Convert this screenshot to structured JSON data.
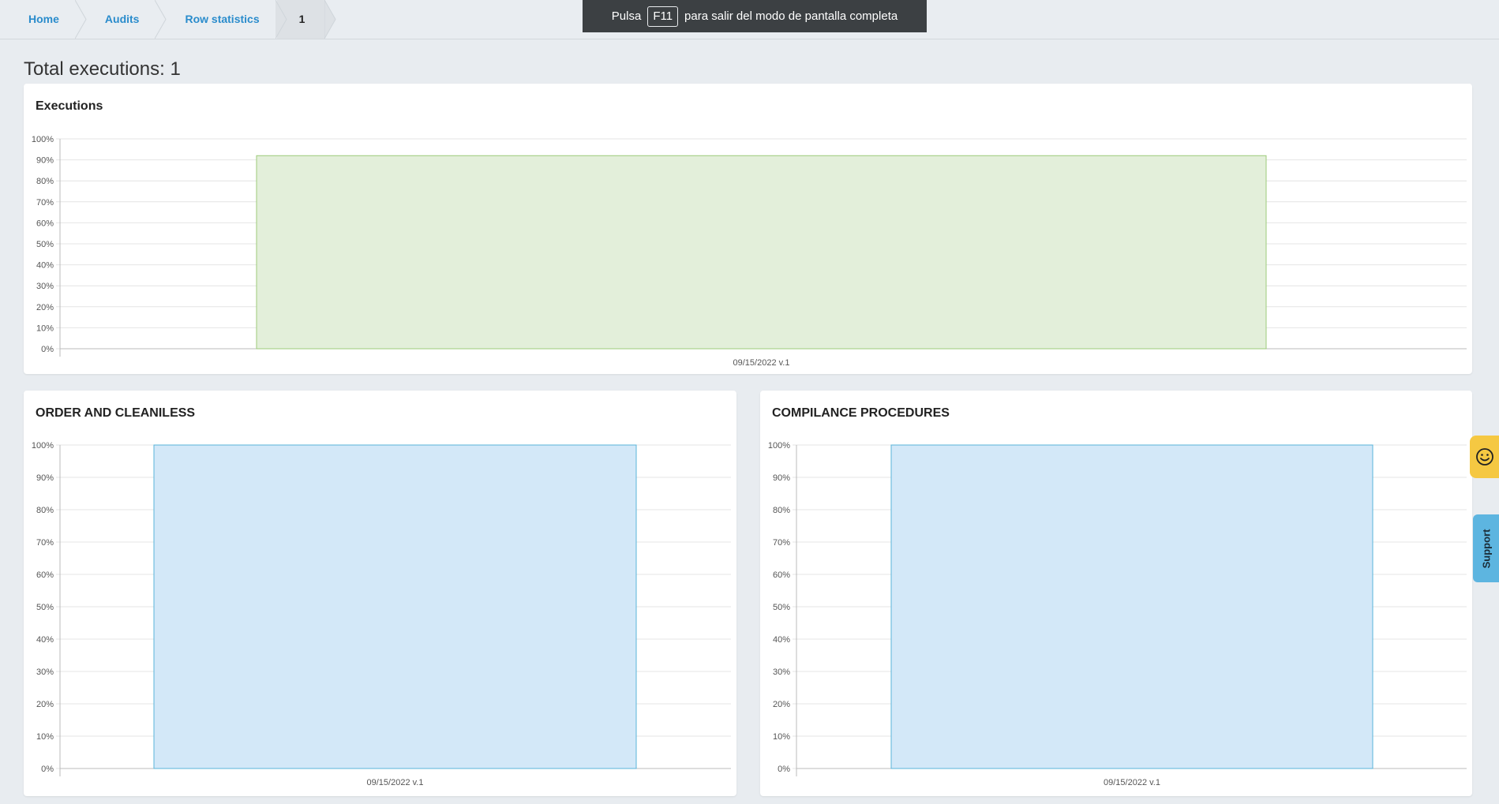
{
  "breadcrumb": {
    "items": [
      {
        "label": "Home"
      },
      {
        "label": "Audits"
      },
      {
        "label": "Row statistics"
      },
      {
        "label": "1"
      }
    ]
  },
  "fullscreen_notice": {
    "before": "Pulsa",
    "key": "F11",
    "after": "para salir del modo de pantalla completa"
  },
  "page": {
    "total_label": "Total executions: 1"
  },
  "panels": {
    "executions": {
      "title": "Executions"
    },
    "order": {
      "title": "ORDER AND CLEANILESS"
    },
    "compliance": {
      "title": "COMPILANCE PROCEDURES"
    }
  },
  "side_tabs": {
    "feedback_icon": "smiley-icon",
    "support_label": "Support"
  },
  "colors": {
    "link": "#2a8ccc",
    "green_fill": "#e3efda",
    "green_stroke": "#9ccb7a",
    "blue_fill": "#d3e8f8",
    "blue_stroke": "#5ab4da",
    "feedback": "#f5c842",
    "support": "#5db5e0"
  },
  "chart_data": [
    {
      "type": "bar",
      "title": "Executions",
      "categories": [
        "09/15/2022 v.1"
      ],
      "values": [
        92
      ],
      "ylim": [
        0,
        100
      ],
      "yticks": [
        "0%",
        "10%",
        "20%",
        "30%",
        "40%",
        "50%",
        "60%",
        "70%",
        "80%",
        "90%",
        "100%"
      ],
      "grid": true
    },
    {
      "type": "bar",
      "title": "ORDER AND CLEANILESS",
      "categories": [
        "09/15/2022 v.1"
      ],
      "values": [
        100
      ],
      "ylim": [
        0,
        100
      ],
      "yticks": [
        "0%",
        "10%",
        "20%",
        "30%",
        "40%",
        "50%",
        "60%",
        "70%",
        "80%",
        "90%",
        "100%"
      ],
      "grid": true
    },
    {
      "type": "bar",
      "title": "COMPILANCE PROCEDURES",
      "categories": [
        "09/15/2022 v.1"
      ],
      "values": [
        100
      ],
      "ylim": [
        0,
        100
      ],
      "yticks": [
        "0%",
        "10%",
        "20%",
        "30%",
        "40%",
        "50%",
        "60%",
        "70%",
        "80%",
        "90%",
        "100%"
      ],
      "grid": true
    }
  ]
}
